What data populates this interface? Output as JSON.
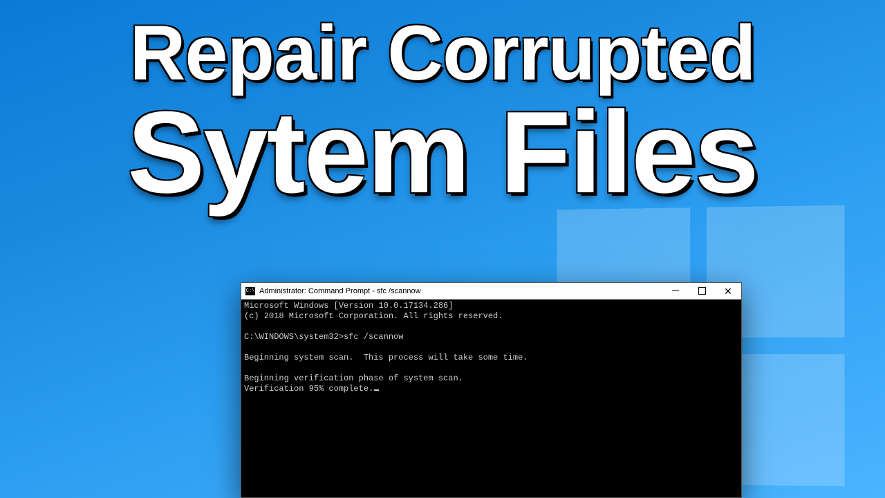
{
  "headline": {
    "line1": "Repair Corrupted",
    "line2": "Sytem Files"
  },
  "cmd": {
    "title": "Administrator: Command Prompt - sfc  /scannow",
    "lines": {
      "l0": "Microsoft Windows [Version 10.0.17134.286]",
      "l1": "(c) 2018 Microsoft Corporation. All rights reserved.",
      "l2": "",
      "l3": "C:\\WINDOWS\\system32>sfc /scannow",
      "l4": "",
      "l5": "Beginning system scan.  This process will take some time.",
      "l6": "",
      "l7": "Beginning verification phase of system scan.",
      "l8": "Verification 95% complete."
    },
    "icon_glyph": "C:\\"
  }
}
